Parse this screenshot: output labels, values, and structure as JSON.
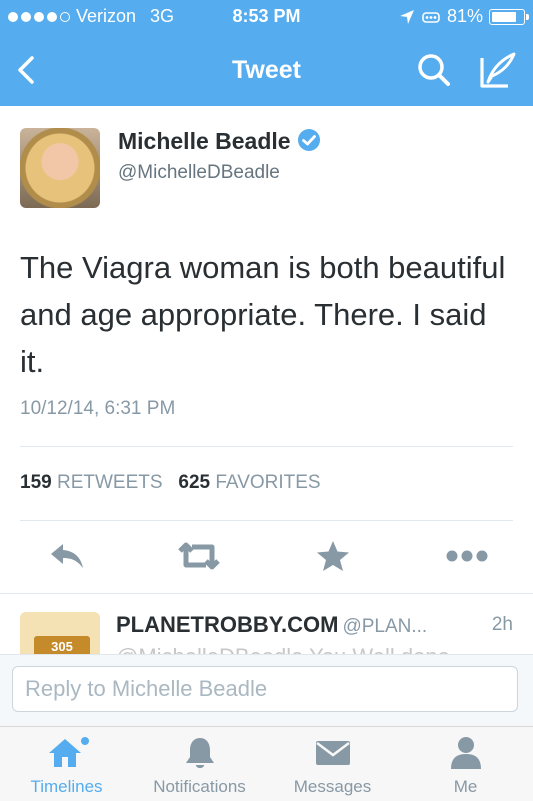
{
  "status_bar": {
    "carrier": "Verizon",
    "network": "3G",
    "time": "8:53 PM",
    "battery": "81%"
  },
  "nav": {
    "title": "Tweet",
    "back_icon": "chevron-left-icon",
    "search_icon": "search-icon",
    "compose_icon": "compose-icon"
  },
  "tweet": {
    "author_name": "Michelle Beadle",
    "author_handle": "@MichelleDBeadle",
    "text": "The Viagra woman is both beautiful and age appropriate. There. I said it.",
    "timestamp": "10/12/14, 6:31 PM",
    "retweets_count": "159",
    "retweets_label": "RETWEETS",
    "favorites_count": "625",
    "favorites_label": "FAVORITES"
  },
  "reply_tweet": {
    "name": "PLANETROBBY.COM",
    "handle": "@PLAN...",
    "time": "2h",
    "badge": "305",
    "text": "@MichelleDBeadle You Well done"
  },
  "reply_box": {
    "placeholder": "Reply to Michelle Beadle"
  },
  "tabs": [
    {
      "label": "Timelines",
      "icon": "home-icon"
    },
    {
      "label": "Notifications",
      "icon": "bell-icon"
    },
    {
      "label": "Messages",
      "icon": "envelope-icon"
    },
    {
      "label": "Me",
      "icon": "person-icon"
    }
  ],
  "colors": {
    "brand": "#55acee",
    "text": "#292f33",
    "muted": "#8899a6"
  }
}
